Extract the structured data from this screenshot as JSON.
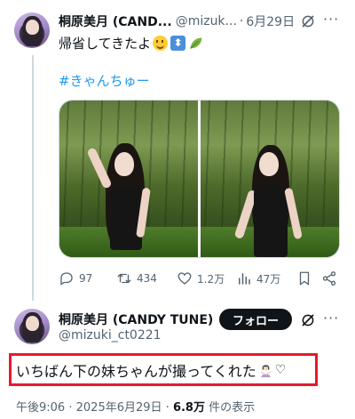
{
  "thread_tweet": {
    "display_name": "桐原美月 (CAND...",
    "handle": "@mizuk...",
    "separator": "·",
    "date": "6月29日",
    "more_label": "···",
    "text": "帰省してきたよ",
    "emojis": [
      "smiling-face",
      "up-down-arrow",
      "leaf"
    ],
    "updown_glyph": "⬍",
    "hashtag": "#きゃんちゅー",
    "photos": [
      "photo-1",
      "photo-2"
    ],
    "stats": {
      "replies": "97",
      "reposts": "434",
      "likes": "1.2万",
      "views": "47万"
    }
  },
  "main_tweet": {
    "display_name": "桐原美月 (CANDY TUNE)",
    "handle": "@mizuki_ct0221",
    "follow_label": "フォロー",
    "more_label": "···",
    "text": "いちばん下の妹ちゃんが撮ってくれた",
    "heart": "♡",
    "emojis": [
      "woman-gesturing",
      "white-heart"
    ],
    "meta": {
      "time": "午後9:06",
      "sep1": "·",
      "date": "2025年6月29日",
      "sep2": "·",
      "views_count": "6.8万",
      "views_label": "件の表示"
    }
  },
  "colors": {
    "accent": "#1d9bf0",
    "text": "#0f1419",
    "secondary": "#536471",
    "highlight_border": "#e5192e",
    "follow_bg": "#0f1419"
  },
  "icons": [
    "reply-icon",
    "repost-icon",
    "like-icon",
    "views-icon",
    "bookmark-icon",
    "share-icon",
    "grok-icon",
    "more-icon"
  ]
}
